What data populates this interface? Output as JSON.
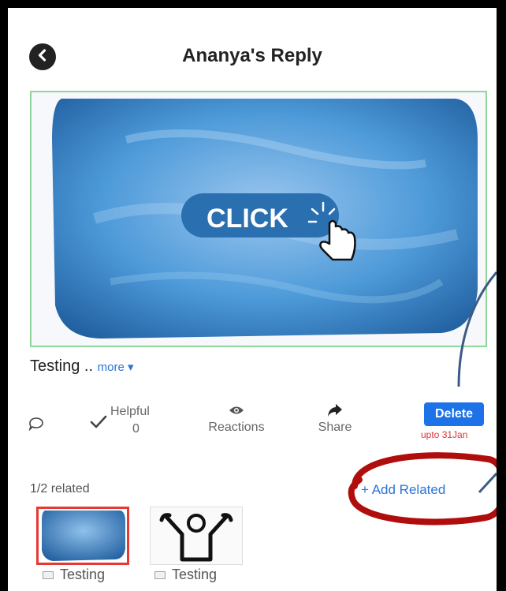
{
  "header": {
    "title": "Ananya's Reply"
  },
  "media": {
    "button_text": "CLICK"
  },
  "post": {
    "caption": "Testing ..",
    "more_label": "more ▾"
  },
  "actions": {
    "helpful_label": "Helpful",
    "helpful_count": "0",
    "reactions_label": "Reactions",
    "share_label": "Share",
    "delete_label": "Delete",
    "delete_note": "upto 31Jan"
  },
  "related": {
    "count_text": "1/2 related",
    "add_label": "+ Add Related",
    "items": [
      {
        "label": "Testing"
      },
      {
        "label": "Testing"
      }
    ]
  },
  "colors": {
    "accent": "#1d72e8",
    "link": "#2a73d8",
    "selected_border": "#e53935",
    "annotation": "#b00d0d",
    "callout_line": "#3b5b86"
  }
}
